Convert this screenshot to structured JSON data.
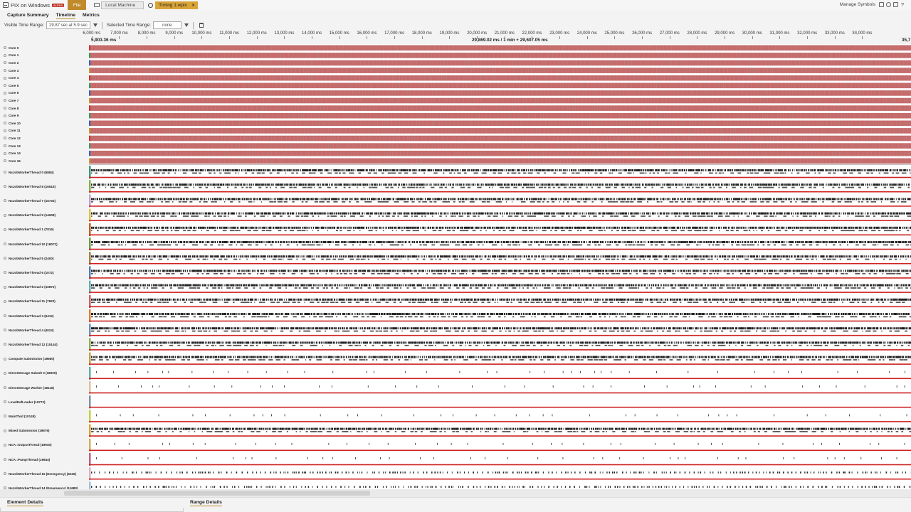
{
  "app": {
    "title": "PIX on Windows",
    "badge": "ALPHA",
    "file_label": "File"
  },
  "tabs": {
    "local": "Local Machine",
    "capture": "Timing 1.wpix",
    "close_glyph": "✕"
  },
  "toolbar": {
    "manage_symbols": "Manage Symbols",
    "help": "?"
  },
  "nav": {
    "items": [
      "Capture Summary",
      "Timeline",
      "Metrics"
    ],
    "active": "Timeline"
  },
  "range": {
    "visible_label": "Visible Time Range:",
    "visible_value": "29.87 sec at 5.9 sec",
    "selected_label": "Selected Time Range:",
    "selected_value": "none"
  },
  "ruler": {
    "start_label": "5,903.36 ms",
    "center_label": "29,869.02 ms / 1 min + 29,607.05 ms",
    "end_label": "35,7",
    "ticks": [
      "6,000 ms",
      "7,000 ms",
      "8,000 ms",
      "9,000 ms",
      "10,000 ms",
      "11,000 ms",
      "12,000 ms",
      "13,000 ms",
      "14,000 ms",
      "15,000 ms",
      "16,000 ms",
      "17,000 ms",
      "18,000 ms",
      "19,000 ms",
      "20,000 ms",
      "21,000 ms",
      "22,000 ms",
      "23,000 ms",
      "24,000 ms",
      "25,000 ms",
      "26,000 ms",
      "27,000 ms",
      "28,000 ms",
      "29,000 ms",
      "30,000 ms",
      "31,000 ms",
      "32,000 ms",
      "33,000 ms",
      "34,000 ms"
    ],
    "tick_start_ms": 6000,
    "tick_step_ms": 1000,
    "range_start_ms": 5903.36,
    "range_end_ms": 35773.36
  },
  "cores": [
    "Core 0",
    "Core 1",
    "Core 2",
    "Core 3",
    "Core 4",
    "Core 5",
    "Core 6",
    "Core 7",
    "Core 8",
    "Core 9",
    "Core 10",
    "Core 11",
    "Core 12",
    "Core 13",
    "Core 14",
    "Core 15"
  ],
  "threads": [
    {
      "name": "NsJobWorkerThread 0 (5884)",
      "activity": "dense",
      "color": "#3a9a7a"
    },
    {
      "name": "NsJobWorkerThread 8 (16516)",
      "activity": "dense",
      "color": "#8ab04a"
    },
    {
      "name": "NsJobWorkerThread 7 (15732)",
      "activity": "dense",
      "color": "#c0a0d0"
    },
    {
      "name": "NsJobWorkerThread 9 (14608)",
      "activity": "dense",
      "color": "#e0c040"
    },
    {
      "name": "NsJobWorkerThread 1 (7816)",
      "activity": "dense",
      "color": "#c06020"
    },
    {
      "name": "NsJobWorkerThread 10 (18072)",
      "activity": "dense",
      "color": "#6aa040"
    },
    {
      "name": "NsJobWorkerThread 5 (2400)",
      "activity": "dense",
      "color": "#a08040"
    },
    {
      "name": "NsJobWorkerThread 6 (1072)",
      "activity": "dense",
      "color": "#5080c0"
    },
    {
      "name": "NsJobWorkerThread 2 (10872)",
      "activity": "dense",
      "color": "#60b0b0"
    },
    {
      "name": "NsJobWorkerThread 11 (7920)",
      "activity": "dense",
      "color": "#d06060"
    },
    {
      "name": "NsJobWorkerThread 3 (5412)",
      "activity": "dense",
      "color": "#e08030"
    },
    {
      "name": "NsJobWorkerThread 4 (4024)",
      "activity": "dense",
      "color": "#7090c0"
    },
    {
      "name": "NsJobWorkerThread 12 (15144)",
      "activity": "dense",
      "color": "#90b050"
    },
    {
      "name": "Compute Submission (19680)",
      "activity": "dense",
      "color": "#c0a040"
    },
    {
      "name": "DirectStorage Submit 0 (18000)",
      "activity": "sparse",
      "color": "#60b0a0"
    },
    {
      "name": "DirectStorage Worker (18116)",
      "activity": "sparse",
      "color": "#e0c0a0"
    },
    {
      "name": "LevelDefLoader (19772)",
      "activity": "empty",
      "color": "#8090a0"
    },
    {
      "name": "MainThrd (10148)",
      "activity": "sparse",
      "color": "#c0d040"
    },
    {
      "name": "Mixed Submission (19676)",
      "activity": "dense",
      "color": "#e0a030"
    },
    {
      "name": "NCA::OutputThread (19940)",
      "activity": "sparse",
      "color": "#d0b060"
    },
    {
      "name": "NCA::PumpThread (19944)",
      "activity": "sparse",
      "color": "#c06080"
    },
    {
      "name": "NsJobWorkerThread 15 (Emergency) (6416)",
      "activity": "medium",
      "color": "#e0b0c0"
    },
    {
      "name": "NsJobWorkerThread 14 (Emergency) (11680)",
      "activity": "medium",
      "color": "#a0c0e0"
    }
  ],
  "bottom": {
    "element_details": "Element Details",
    "range_details": "Range Details"
  },
  "colors": {
    "accent": "#c08a2a",
    "core_fill": "#c86a6a",
    "core_stripe": "#9a9a9a",
    "thread_event": "#222222",
    "thread_baseline": "#d02020"
  }
}
